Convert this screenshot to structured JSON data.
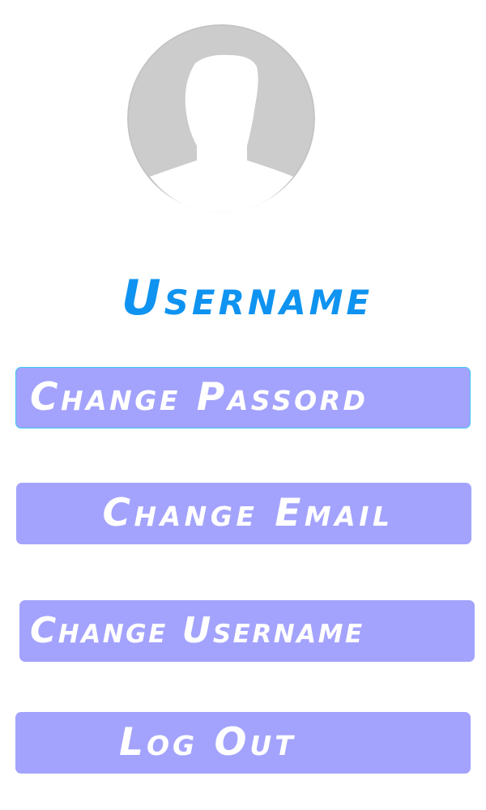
{
  "profile": {
    "avatar_icon": "user-silhouette-icon",
    "username": "Username"
  },
  "actions": {
    "change_password": "Change Passord",
    "change_email": "Change Email",
    "change_username": "Change Username",
    "log_out": "Log Out"
  },
  "colors": {
    "username_text": "#0f93f0",
    "button_bg": "#a3a3fd",
    "button_text": "#ffffff",
    "focus_border": "#3fc8f2",
    "avatar_bg": "#cccccc"
  }
}
